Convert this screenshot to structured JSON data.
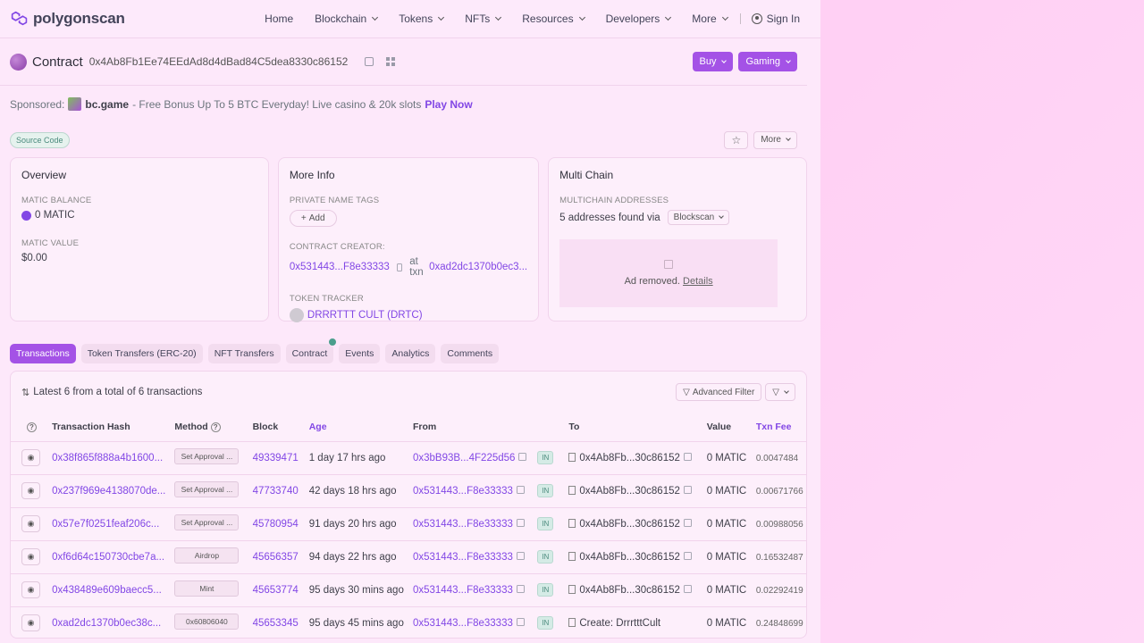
{
  "header": {
    "logo_text": "polygonscan",
    "nav": [
      "Home",
      "Blockchain",
      "Tokens",
      "NFTs",
      "Resources",
      "Developers",
      "More"
    ],
    "signin": "Sign In"
  },
  "contract": {
    "label": "Contract",
    "address": "0x4Ab8Fb1Ee74EEdAd8d4dBad84C5dea8330c86152",
    "buy": "Buy",
    "gaming": "Gaming"
  },
  "sponsored": {
    "prefix": "Sponsored:",
    "name": "bc.game",
    "text": "- Free Bonus Up To 5 BTC Everyday! Live casino & 20k slots",
    "cta": "Play Now"
  },
  "badges": {
    "source_code": "Source Code",
    "more": "More"
  },
  "overview": {
    "title": "Overview",
    "balance_label": "MATIC BALANCE",
    "balance_value": "0 MATIC",
    "value_label": "MATIC VALUE",
    "value_value": "$0.00"
  },
  "moreinfo": {
    "title": "More Info",
    "tags_label": "PRIVATE NAME TAGS",
    "add": "Add",
    "creator_label": "CONTRACT CREATOR:",
    "creator": "0x531443...F8e33333",
    "at_txn": "at txn",
    "creator_txn": "0xad2dc1370b0ec3...",
    "token_label": "TOKEN TRACKER",
    "token": "DRRRTTT CULT (DRTC)"
  },
  "multichain": {
    "title": "Multi Chain",
    "label": "MULTICHAIN ADDRESSES",
    "found": "5 addresses found via",
    "blockscan": "Blockscan",
    "ad_text": "Ad removed.",
    "ad_link": "Details"
  },
  "tabs": [
    "Transactions",
    "Token Transfers (ERC-20)",
    "NFT Transfers",
    "Contract",
    "Events",
    "Analytics",
    "Comments"
  ],
  "txsummary": {
    "text": "Latest 6 from a total of 6 transactions",
    "advanced_filter": "Advanced Filter"
  },
  "table": {
    "headers": [
      "Transaction Hash",
      "Method",
      "Block",
      "Age",
      "From",
      "To",
      "Value",
      "Txn Fee"
    ],
    "rows": [
      {
        "hash": "0x38f865f888a4b1600...",
        "method": "Set Approval ...",
        "block": "49339471",
        "age": "1 day 17 hrs ago",
        "from": "0x3bB93B...4F225d56",
        "dir": "IN",
        "to": "0x4Ab8Fb...30c86152",
        "value": "0 MATIC",
        "fee": "0.0047484"
      },
      {
        "hash": "0x237f969e4138070de...",
        "method": "Set Approval ...",
        "block": "47733740",
        "age": "42 days 18 hrs ago",
        "from": "0x531443...F8e33333",
        "dir": "IN",
        "to": "0x4Ab8Fb...30c86152",
        "value": "0 MATIC",
        "fee": "0.00671766"
      },
      {
        "hash": "0x57e7f0251feaf206c...",
        "method": "Set Approval ...",
        "block": "45780954",
        "age": "91 days 20 hrs ago",
        "from": "0x531443...F8e33333",
        "dir": "IN",
        "to": "0x4Ab8Fb...30c86152",
        "value": "0 MATIC",
        "fee": "0.00988056"
      },
      {
        "hash": "0xf6d64c150730cbe7a...",
        "method": "Airdrop",
        "block": "45656357",
        "age": "94 days 22 hrs ago",
        "from": "0x531443...F8e33333",
        "dir": "IN",
        "to": "0x4Ab8Fb...30c86152",
        "value": "0 MATIC",
        "fee": "0.16532487"
      },
      {
        "hash": "0x438489e609baecc5...",
        "method": "Mint",
        "block": "45653774",
        "age": "95 days 30 mins ago",
        "from": "0x531443...F8e33333",
        "dir": "IN",
        "to": "0x4Ab8Fb...30c86152",
        "value": "0 MATIC",
        "fee": "0.02292419"
      },
      {
        "hash": "0xad2dc1370b0ec38c...",
        "method": "0x60806040",
        "block": "45653345",
        "age": "95 days 45 mins ago",
        "from": "0x531443...F8e33333",
        "dir": "IN",
        "to": "Create: DrrrtttCult",
        "value": "0 MATIC",
        "fee": "0.24848699"
      }
    ]
  },
  "colors": {
    "accent": "#8247e5",
    "button": "#a452e6",
    "background": "#fde8fa"
  }
}
